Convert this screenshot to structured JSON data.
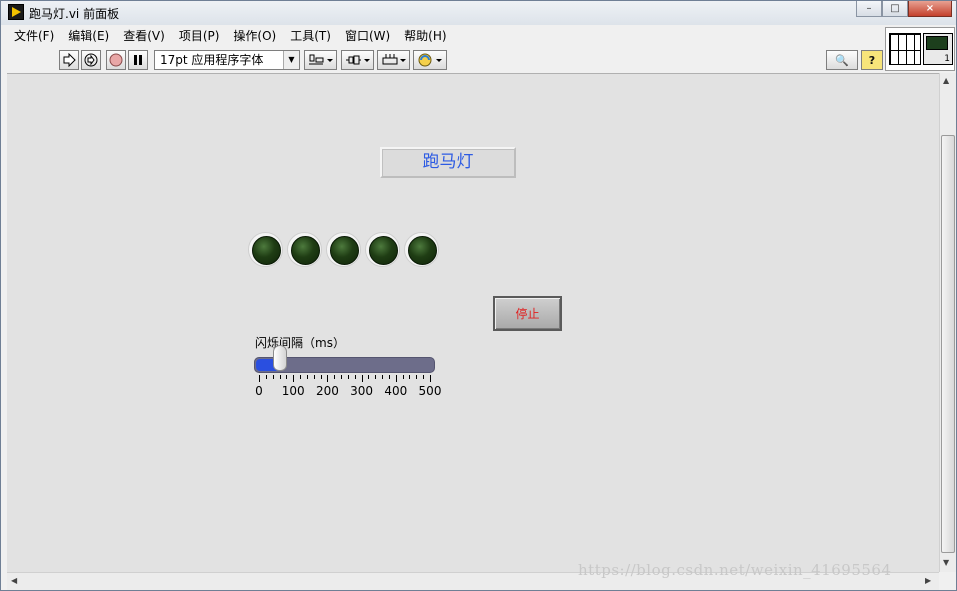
{
  "window": {
    "title": "跑马灯.vi 前面板",
    "minimize": "–",
    "restore": "□",
    "close": "×"
  },
  "menu": [
    "文件(F)",
    "编辑(E)",
    "查看(V)",
    "项目(P)",
    "操作(O)",
    "工具(T)",
    "窗口(W)",
    "帮助(H)"
  ],
  "toolbar": {
    "font": "17pt 应用程序字体",
    "help_glyph": "?",
    "search_glyph": "🔍"
  },
  "icon_pane": {
    "connector_number": "1"
  },
  "front_panel": {
    "title_label": "跑马灯",
    "led_count": 5,
    "stop_label": "停止",
    "slider": {
      "label": "闪烁间隔（ms）",
      "min": 0,
      "max": 500,
      "value": 60,
      "tick_labels": [
        "0",
        "100",
        "200",
        "300",
        "400",
        "500"
      ]
    }
  },
  "watermark": "https://blog.csdn.net/weixin_41695564",
  "colors": {
    "title_text": "#2d5be3",
    "stop_text": "#e02020",
    "slider_fill": "#2a4fe0",
    "led_off": "#1f3d14"
  }
}
